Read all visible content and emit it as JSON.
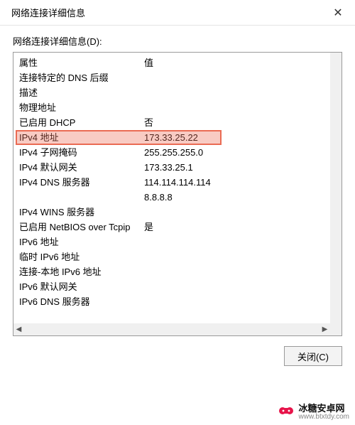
{
  "window": {
    "title": "网络连接详细信息",
    "close_symbol": "✕"
  },
  "section_label": "网络连接详细信息(D):",
  "columns": {
    "prop": "属性",
    "val": "值"
  },
  "rows": [
    {
      "prop": "连接特定的 DNS 后缀",
      "val": ""
    },
    {
      "prop": "描述",
      "val": ""
    },
    {
      "prop": "物理地址",
      "val": ""
    },
    {
      "prop": "已启用 DHCP",
      "val": "否"
    },
    {
      "prop": "IPv4 地址",
      "val": "173.33.25.22"
    },
    {
      "prop": "IPv4 子网掩码",
      "val": "255.255.255.0"
    },
    {
      "prop": "IPv4 默认网关",
      "val": "173.33.25.1"
    },
    {
      "prop": "IPv4 DNS 服务器",
      "val": "114.114.114.114"
    },
    {
      "prop": "",
      "val": "8.8.8.8"
    },
    {
      "prop": "IPv4 WINS 服务器",
      "val": ""
    },
    {
      "prop": "已启用 NetBIOS over Tcpip",
      "val": "是"
    },
    {
      "prop": "IPv6 地址",
      "val": ""
    },
    {
      "prop": "临时 IPv6 地址",
      "val": ""
    },
    {
      "prop": "连接-本地 IPv6 地址",
      "val": ""
    },
    {
      "prop": "IPv6 默认网关",
      "val": ""
    },
    {
      "prop": "IPv6 DNS 服务器",
      "val": ""
    }
  ],
  "buttons": {
    "close": "关闭(C)"
  },
  "watermark": {
    "main": "冰糖安卓网",
    "sub": "www.btxtdy.com"
  },
  "scroll": {
    "left": "◀",
    "right": "▶"
  },
  "highlight_row_index": 4
}
